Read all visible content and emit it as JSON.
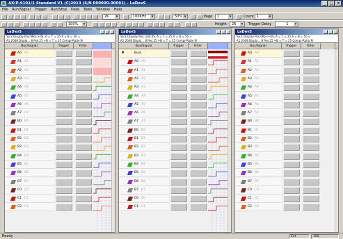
{
  "window": {
    "title": "AKIP-9101/1 Standard V1 (C)2013 (S/N 000000-00001) - LaDevS",
    "min_glyph": "_",
    "max_glyph": "□",
    "close_glyph": "×"
  },
  "menu": [
    "File",
    "Run/Signal",
    "Trigger",
    "Run/Stop",
    "Data",
    "Tools",
    "Window",
    "Help"
  ],
  "toolbar1": {
    "samples_value": "2K",
    "rate_value": "100KHz",
    "threshold_value": "50%",
    "page_label": "Page",
    "page_value": "1",
    "count_label": "Count",
    "count_value": "1"
  },
  "toolbar2": {
    "zoom_value": "100%",
    "height_label": "Height",
    "height_value": "26",
    "trigger_delay_label": "Trigger Delay",
    "trigger_delay_value": "1"
  },
  "panels": [
    {
      "title": "LaDevS",
      "info1": "Sa:2   Display Pos:0Pos:+0S, A = T = 25 A = B = 50 =",
      "info2": "A1 2048 Displa... 8 Pos:25 +B = T = 25 Compr-Ratio Ri",
      "headers": {
        "signal": "Bus/Signal",
        "trigger": "Trigger",
        "filter": "Filter"
      }
    },
    {
      "title": "LaDevS",
      "info1": "Sa:1   Display Pos:-100.0S, A = T = 25 A = B = 50 =",
      "info2": "A1 2048 Displa... 8 Pos:25 +B = T = 25 Compr-Ratio Ri",
      "headers": {
        "signal": "Bus/Signal",
        "trigger": "Trigger",
        "filter": "Filter"
      }
    },
    {
      "title": "LaDevS",
      "info1": "Sa:1   Display Pos:0Pos:+0S, A = T = 25 A = B = 50 =",
      "info2": "A1 2048 Displa... 8 Pos:25 +B = T = 25 Compr-Ratio Ri",
      "headers": {
        "signal": "Bus/Signal",
        "trigger": "Trigger",
        "filter": "Filter"
      }
    }
  ],
  "panel1_rows": [
    {
      "name": "A0",
      "alias": "A0",
      "color": "#d01010"
    },
    {
      "name": "A1",
      "alias": "A1",
      "color": "#e03030"
    },
    {
      "name": "A2",
      "alias": "A2",
      "color": "#e06020"
    },
    {
      "name": "A3",
      "alias": "A3",
      "color": "#e0b020"
    },
    {
      "name": "A4",
      "alias": "A4",
      "color": "#30b030"
    },
    {
      "name": "A5",
      "alias": "A5",
      "color": "#4040e0"
    },
    {
      "name": "A6",
      "alias": "A6",
      "color": "#a030c0"
    },
    {
      "name": "A7",
      "alias": "A7",
      "color": "#808080"
    },
    {
      "name": "B0",
      "alias": "B0",
      "color": "#7a2020"
    },
    {
      "name": "B1",
      "alias": "B1",
      "color": "#d01010"
    },
    {
      "name": "B2",
      "alias": "B2",
      "color": "#e06020"
    },
    {
      "name": "B3",
      "alias": "B3",
      "color": "#e0b020"
    },
    {
      "name": "B4",
      "alias": "B4",
      "color": "#30b030"
    },
    {
      "name": "B5",
      "alias": "B5",
      "color": "#4040e0"
    },
    {
      "name": "B6",
      "alias": "B6",
      "color": "#a030c0"
    },
    {
      "name": "B7",
      "alias": "B7",
      "color": "#808080"
    },
    {
      "name": "C0",
      "alias": "C0",
      "color": "#7a2020"
    },
    {
      "name": "C1",
      "alias": "C1",
      "color": "#d01010"
    },
    {
      "name": "C2",
      "alias": "C2",
      "color": "#e06020"
    }
  ],
  "panel2_rows": [
    {
      "name": "Bus1",
      "alias": "",
      "color": "",
      "bus": true
    },
    {
      "name": "A0",
      "alias": "A0",
      "color": "#d01010"
    },
    {
      "name": "A1",
      "alias": "A1",
      "color": "#e03030"
    },
    {
      "name": "A2",
      "alias": "A2",
      "color": "#e06020"
    },
    {
      "name": "A3",
      "alias": "A3",
      "color": "#e0b020"
    },
    {
      "name": "A4",
      "alias": "A4",
      "color": "#30b030"
    },
    {
      "name": "A5",
      "alias": "A5",
      "color": "#4040e0"
    },
    {
      "name": "A6",
      "alias": "A6",
      "color": "#a030c0"
    },
    {
      "name": "A7",
      "alias": "A7",
      "color": "#808080"
    },
    {
      "name": "B0",
      "alias": "B0",
      "color": "#7a2020"
    },
    {
      "name": "B1",
      "alias": "B1",
      "color": "#d01010"
    },
    {
      "name": "B2",
      "alias": "B2",
      "color": "#e06020"
    },
    {
      "name": "B3",
      "alias": "B3",
      "color": "#e0b020"
    },
    {
      "name": "B4",
      "alias": "B4",
      "color": "#30b030"
    },
    {
      "name": "B5",
      "alias": "B5",
      "color": "#4040e0"
    },
    {
      "name": "B6",
      "alias": "B6",
      "color": "#a030c0"
    },
    {
      "name": "B7",
      "alias": "B7",
      "color": "#808080"
    },
    {
      "name": "C0",
      "alias": "C0",
      "color": "#7a2020"
    },
    {
      "name": "C1",
      "alias": "C1",
      "color": "#d01010"
    }
  ],
  "panel3_rows": [
    {
      "name": "A0",
      "alias": "A0",
      "color": "#d01010"
    },
    {
      "name": "A1",
      "alias": "A1",
      "color": "#e03030"
    },
    {
      "name": "A2",
      "alias": "A2",
      "color": "#e06020"
    },
    {
      "name": "A3",
      "alias": "A3",
      "color": "#e0b020"
    },
    {
      "name": "A4",
      "alias": "A4",
      "color": "#30b030"
    },
    {
      "name": "A5",
      "alias": "A5",
      "color": "#4040e0"
    },
    {
      "name": "A6",
      "alias": "A6",
      "color": "#a030c0"
    },
    {
      "name": "A7",
      "alias": "A7",
      "color": "#808080"
    },
    {
      "name": "B0",
      "alias": "B0",
      "color": "#7a2020"
    },
    {
      "name": "B1",
      "alias": "B1",
      "color": "#d01010"
    },
    {
      "name": "B2",
      "alias": "B2",
      "color": "#e06020"
    },
    {
      "name": "B3",
      "alias": "B3",
      "color": "#e0b020"
    },
    {
      "name": "B4",
      "alias": "B4",
      "color": "#30b030"
    },
    {
      "name": "B5",
      "alias": "B5",
      "color": "#4040e0"
    },
    {
      "name": "B6",
      "alias": "B6",
      "color": "#a030c0"
    },
    {
      "name": "B7",
      "alias": "B7",
      "color": "#808080"
    },
    {
      "name": "C0",
      "alias": "C0",
      "color": "#7a2020"
    },
    {
      "name": "C1",
      "alias": "C1",
      "color": "#d01010"
    },
    {
      "name": "C2",
      "alias": "C2",
      "color": "#e06020"
    }
  ],
  "status": {
    "left": "Ready",
    "right1": "Ext",
    "right2": "100"
  },
  "colors": {
    "bus_block": "#8b0000",
    "bus_block2": "#cc2020",
    "grid_line": "#b0b0ff"
  }
}
